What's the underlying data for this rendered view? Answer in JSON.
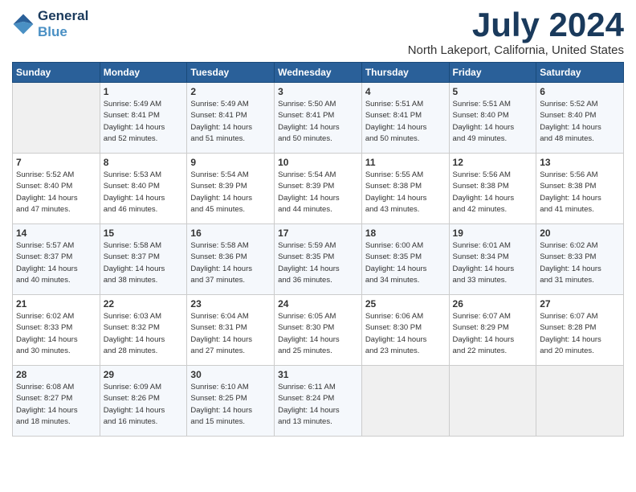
{
  "header": {
    "logo_line1": "General",
    "logo_line2": "Blue",
    "month_year": "July 2024",
    "location": "North Lakeport, California, United States"
  },
  "weekdays": [
    "Sunday",
    "Monday",
    "Tuesday",
    "Wednesday",
    "Thursday",
    "Friday",
    "Saturday"
  ],
  "weeks": [
    [
      {
        "day": "",
        "info": ""
      },
      {
        "day": "1",
        "info": "Sunrise: 5:49 AM\nSunset: 8:41 PM\nDaylight: 14 hours\nand 52 minutes."
      },
      {
        "day": "2",
        "info": "Sunrise: 5:49 AM\nSunset: 8:41 PM\nDaylight: 14 hours\nand 51 minutes."
      },
      {
        "day": "3",
        "info": "Sunrise: 5:50 AM\nSunset: 8:41 PM\nDaylight: 14 hours\nand 50 minutes."
      },
      {
        "day": "4",
        "info": "Sunrise: 5:51 AM\nSunset: 8:41 PM\nDaylight: 14 hours\nand 50 minutes."
      },
      {
        "day": "5",
        "info": "Sunrise: 5:51 AM\nSunset: 8:40 PM\nDaylight: 14 hours\nand 49 minutes."
      },
      {
        "day": "6",
        "info": "Sunrise: 5:52 AM\nSunset: 8:40 PM\nDaylight: 14 hours\nand 48 minutes."
      }
    ],
    [
      {
        "day": "7",
        "info": "Sunrise: 5:52 AM\nSunset: 8:40 PM\nDaylight: 14 hours\nand 47 minutes."
      },
      {
        "day": "8",
        "info": "Sunrise: 5:53 AM\nSunset: 8:40 PM\nDaylight: 14 hours\nand 46 minutes."
      },
      {
        "day": "9",
        "info": "Sunrise: 5:54 AM\nSunset: 8:39 PM\nDaylight: 14 hours\nand 45 minutes."
      },
      {
        "day": "10",
        "info": "Sunrise: 5:54 AM\nSunset: 8:39 PM\nDaylight: 14 hours\nand 44 minutes."
      },
      {
        "day": "11",
        "info": "Sunrise: 5:55 AM\nSunset: 8:38 PM\nDaylight: 14 hours\nand 43 minutes."
      },
      {
        "day": "12",
        "info": "Sunrise: 5:56 AM\nSunset: 8:38 PM\nDaylight: 14 hours\nand 42 minutes."
      },
      {
        "day": "13",
        "info": "Sunrise: 5:56 AM\nSunset: 8:38 PM\nDaylight: 14 hours\nand 41 minutes."
      }
    ],
    [
      {
        "day": "14",
        "info": "Sunrise: 5:57 AM\nSunset: 8:37 PM\nDaylight: 14 hours\nand 40 minutes."
      },
      {
        "day": "15",
        "info": "Sunrise: 5:58 AM\nSunset: 8:37 PM\nDaylight: 14 hours\nand 38 minutes."
      },
      {
        "day": "16",
        "info": "Sunrise: 5:58 AM\nSunset: 8:36 PM\nDaylight: 14 hours\nand 37 minutes."
      },
      {
        "day": "17",
        "info": "Sunrise: 5:59 AM\nSunset: 8:35 PM\nDaylight: 14 hours\nand 36 minutes."
      },
      {
        "day": "18",
        "info": "Sunrise: 6:00 AM\nSunset: 8:35 PM\nDaylight: 14 hours\nand 34 minutes."
      },
      {
        "day": "19",
        "info": "Sunrise: 6:01 AM\nSunset: 8:34 PM\nDaylight: 14 hours\nand 33 minutes."
      },
      {
        "day": "20",
        "info": "Sunrise: 6:02 AM\nSunset: 8:33 PM\nDaylight: 14 hours\nand 31 minutes."
      }
    ],
    [
      {
        "day": "21",
        "info": "Sunrise: 6:02 AM\nSunset: 8:33 PM\nDaylight: 14 hours\nand 30 minutes."
      },
      {
        "day": "22",
        "info": "Sunrise: 6:03 AM\nSunset: 8:32 PM\nDaylight: 14 hours\nand 28 minutes."
      },
      {
        "day": "23",
        "info": "Sunrise: 6:04 AM\nSunset: 8:31 PM\nDaylight: 14 hours\nand 27 minutes."
      },
      {
        "day": "24",
        "info": "Sunrise: 6:05 AM\nSunset: 8:30 PM\nDaylight: 14 hours\nand 25 minutes."
      },
      {
        "day": "25",
        "info": "Sunrise: 6:06 AM\nSunset: 8:30 PM\nDaylight: 14 hours\nand 23 minutes."
      },
      {
        "day": "26",
        "info": "Sunrise: 6:07 AM\nSunset: 8:29 PM\nDaylight: 14 hours\nand 22 minutes."
      },
      {
        "day": "27",
        "info": "Sunrise: 6:07 AM\nSunset: 8:28 PM\nDaylight: 14 hours\nand 20 minutes."
      }
    ],
    [
      {
        "day": "28",
        "info": "Sunrise: 6:08 AM\nSunset: 8:27 PM\nDaylight: 14 hours\nand 18 minutes."
      },
      {
        "day": "29",
        "info": "Sunrise: 6:09 AM\nSunset: 8:26 PM\nDaylight: 14 hours\nand 16 minutes."
      },
      {
        "day": "30",
        "info": "Sunrise: 6:10 AM\nSunset: 8:25 PM\nDaylight: 14 hours\nand 15 minutes."
      },
      {
        "day": "31",
        "info": "Sunrise: 6:11 AM\nSunset: 8:24 PM\nDaylight: 14 hours\nand 13 minutes."
      },
      {
        "day": "",
        "info": ""
      },
      {
        "day": "",
        "info": ""
      },
      {
        "day": "",
        "info": ""
      }
    ]
  ]
}
